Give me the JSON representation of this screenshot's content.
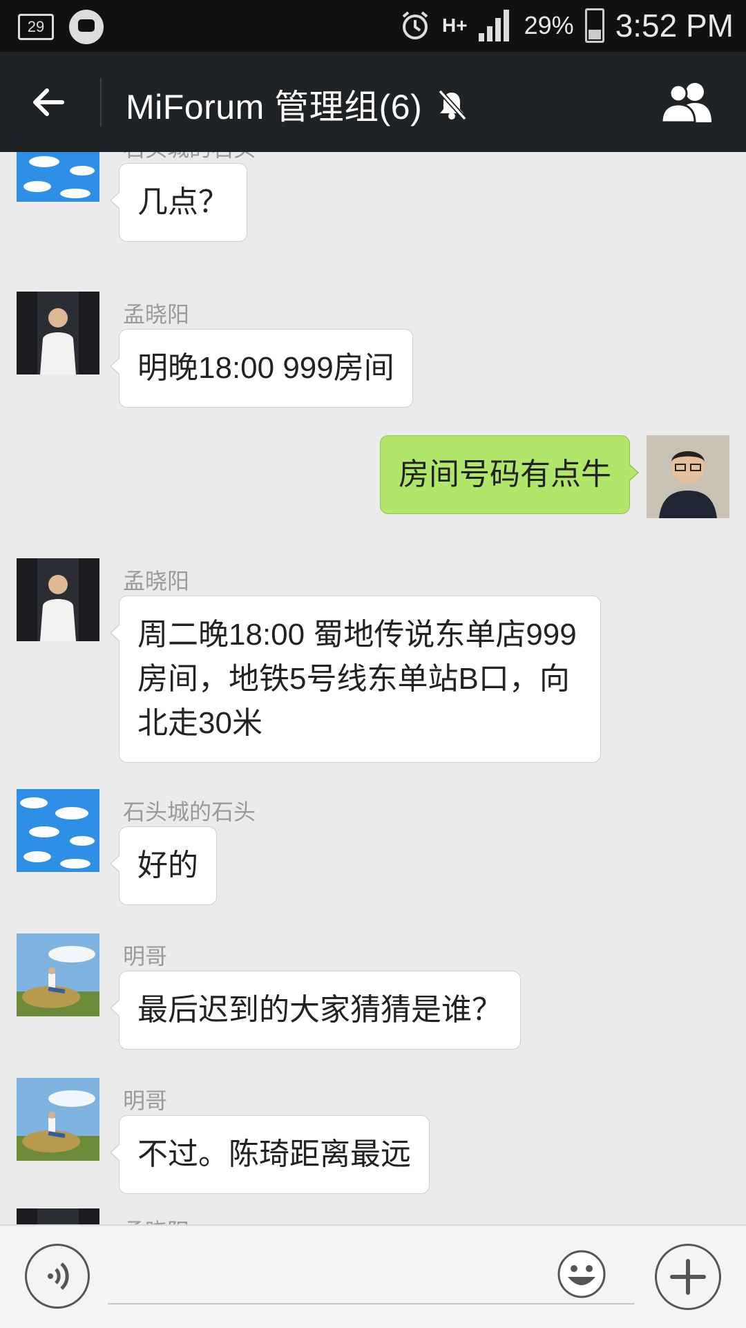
{
  "status_bar": {
    "notification_count": "29",
    "network": "H+",
    "battery_percent": "29%",
    "time": "3:52 PM"
  },
  "header": {
    "title": "MiForum 管理组(6)",
    "muted": true
  },
  "messages": [
    {
      "side": "left",
      "sender": "石头城的石头",
      "text": "几点？",
      "avatar": "sky-avatar"
    },
    {
      "side": "left",
      "sender": "孟晓阳",
      "text": "明晚18:00 999房间",
      "avatar": "doctor-avatar"
    },
    {
      "side": "right",
      "sender": "",
      "text": "房间号码有点牛",
      "avatar": "self-avatar"
    },
    {
      "side": "left",
      "sender": "孟晓阳",
      "text": "周二晚18:00  蜀地传说东单店999房间，地铁5号线东单站B口，向北走30米",
      "avatar": "doctor-avatar"
    },
    {
      "side": "left",
      "sender": "石头城的石头",
      "text": "好的",
      "avatar": "sky-avatar"
    },
    {
      "side": "left",
      "sender": "明哥",
      "text": "最后迟到的大家猜猜是谁？",
      "avatar": "field-avatar"
    },
    {
      "side": "left",
      "sender": "明哥",
      "text": "不过。陈琦距离最远",
      "avatar": "field-avatar"
    },
    {
      "side": "left",
      "sender": "孟晓阳",
      "text": "",
      "avatar": "doctor-avatar"
    }
  ],
  "input_bar": {
    "placeholder": "",
    "value": ""
  },
  "colors": {
    "header_bg": "#1f2326",
    "chat_bg": "#ebebeb",
    "own_bubble": "#b1e66a",
    "other_bubble": "#ffffff"
  }
}
